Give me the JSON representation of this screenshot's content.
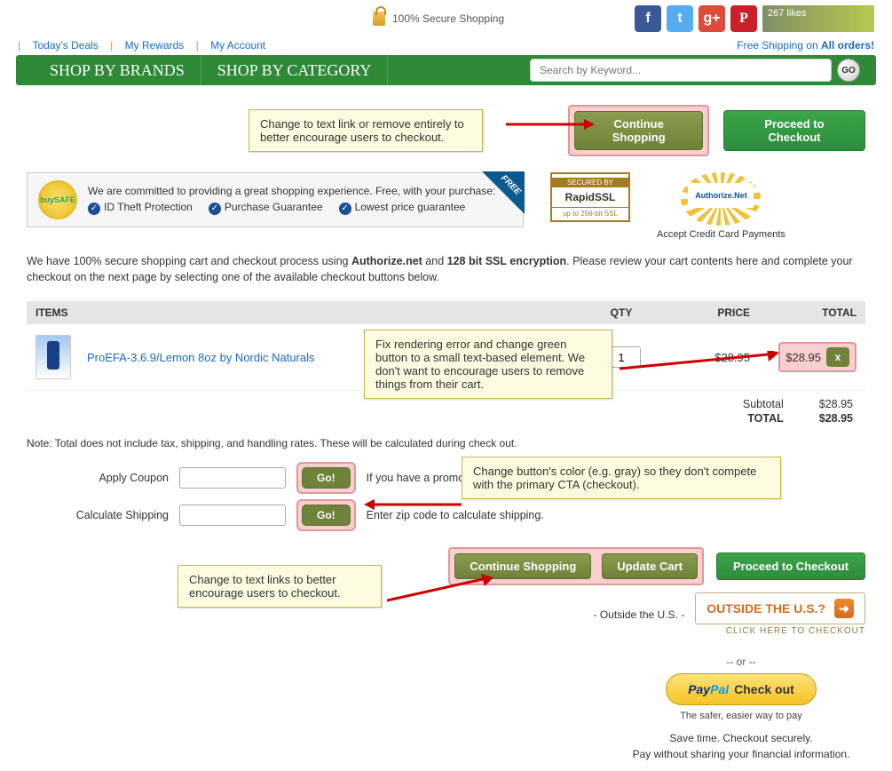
{
  "topbar": {
    "secure": "100% Secure Shopping",
    "likes": "267 likes"
  },
  "links": {
    "deals": "Today's Deals",
    "rewards": "My Rewards",
    "account": "My Account",
    "free_ship_pre": "Free Shipping on ",
    "free_ship_b": "All orders!"
  },
  "nav": {
    "brands": "SHOP BY BRANDS",
    "category": "SHOP BY CATEGORY",
    "search_placeholder": "Search by Keyword...",
    "go": "GO"
  },
  "annot": {
    "top": "Change to text link or remove entirely to better encourage users to checkout.",
    "remove": "Fix rendering error and change green button to a small text-based element. We don't want to encourage users to remove things from their cart.",
    "color": "Change button's color (e.g. gray) so they don't compete with the primary CTA (checkout).",
    "bottom": "Change to text links to better encourage users to checkout."
  },
  "buttons": {
    "continue": "Continue Shopping",
    "checkout": "Proceed to Checkout",
    "go": "Go!",
    "update": "Update Cart",
    "remove": "x"
  },
  "trust": {
    "buysafe_line": "We are committed to providing a great shopping experience. Free, with your purchase:",
    "g1": "ID Theft Protection",
    "g2": "Purchase Guarantee",
    "g3": "Lowest price guarantee",
    "rapid_top": "SECURED BY",
    "rapid_mid": "RapidSSL",
    "rapid_bot": "up to 256-bit SSL",
    "auth_name": "Authorize.Net",
    "auth_sub": "Accept Credit Card Payments"
  },
  "intro": {
    "p1": "We have 100% secure shopping cart and checkout process using ",
    "b1": "Authorize.net",
    "p2": " and ",
    "b2": "128 bit SSL encryption",
    "p3": ". Please review your cart contents here and complete your checkout on the next page by selecting one of the available checkout buttons below."
  },
  "cart": {
    "h_items": "ITEMS",
    "h_qty": "QTY",
    "h_price": "PRICE",
    "h_total": "TOTAL",
    "product": "ProEFA-3.6.9/Lemon 8oz by Nordic Naturals",
    "qty": "1",
    "price": "$28.95",
    "line_total": "$28.95",
    "subtotal_label": "Subtotal",
    "subtotal_val": "$28.95",
    "total_label": "TOTAL",
    "total_val": "$28.95"
  },
  "note": "Note: Total does not include tax, shipping, and handling rates. These will be calculated during check out.",
  "coupon": {
    "label": "Apply Coupon",
    "hint": "If you have a promotion"
  },
  "shipping": {
    "label": "Calculate Shipping",
    "hint": "Enter zip code to calculate shipping."
  },
  "outside": {
    "label": "- Outside the U.S. -",
    "btn": "OUTSIDE THE U.S.?",
    "sub": "CLICK HERE TO CHECKOUT"
  },
  "paypal": {
    "or": "-- or --",
    "brand1": "Pay",
    "brand2": "Pal",
    "co": "Check out",
    "sub": "The safer, easier way to pay",
    "save": "Save time. Checkout securely.",
    "without": "Pay without sharing your financial information."
  }
}
